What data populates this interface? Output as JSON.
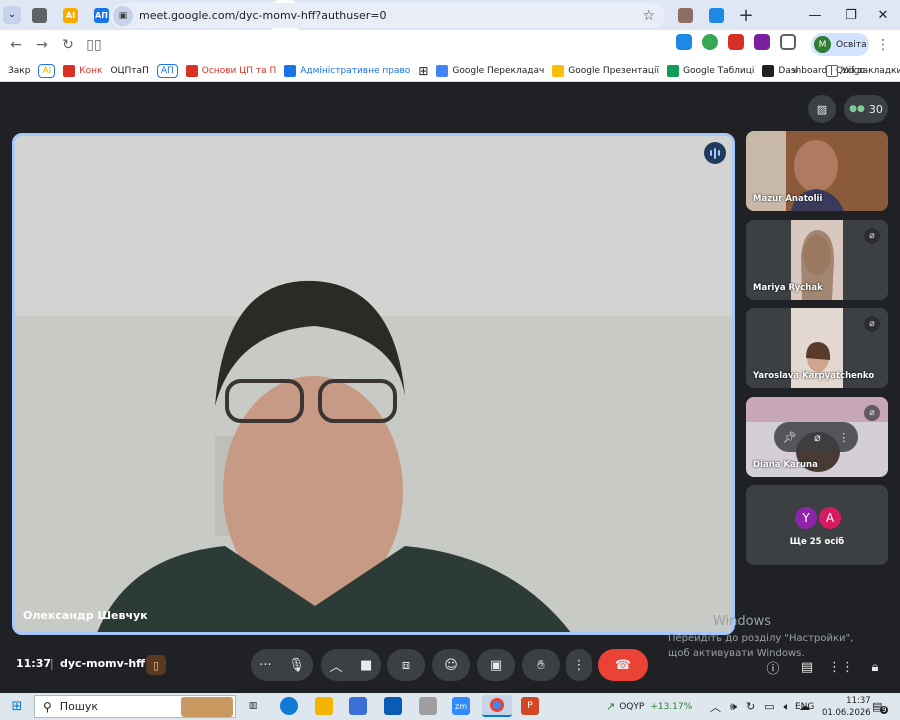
{
  "browser": {
    "tabs": [
      {
        "icon": "chrome-icon",
        "color": "#5f6368",
        "label": ""
      },
      {
        "icon": "ai-icon",
        "color": "#f9ab00",
        "label": "AI"
      },
      {
        "icon": "ap-icon",
        "color": "#1a73e8",
        "label": "АП"
      },
      {
        "icon": "graduation-icon",
        "color": "#8a5a2b",
        "label": ""
      },
      {
        "icon": "chrome-icon",
        "color": "#5f6368",
        "label": ""
      },
      {
        "icon": "drive-icon",
        "color": "#34a853",
        "label": ""
      },
      {
        "icon": "sheets-icon",
        "color": "#0f9d58",
        "label": ""
      },
      {
        "icon": "image-icon",
        "color": "#1a73e8",
        "label": ""
      },
      {
        "icon": "meet-icon",
        "color": "#fbbc04",
        "label": ""
      },
      {
        "icon": "openai-icon",
        "color": "#202124",
        "label": ""
      },
      {
        "icon": "slides-icon",
        "color": "#fbbc04",
        "label": ""
      },
      {
        "icon": "slides-icon",
        "color": "#fbbc04",
        "label": ""
      },
      {
        "icon": "trident-icon",
        "color": "#1a3f9e",
        "label": ""
      },
      {
        "icon": "trident-icon",
        "color": "#1a3f9e",
        "label": ""
      },
      {
        "icon": "trident-icon",
        "color": "#1a3f9e",
        "label": ""
      },
      {
        "icon": "trident-icon",
        "color": "#1a3f9e",
        "label": ""
      },
      {
        "icon": "trident-icon",
        "color": "#1a3f9e",
        "label": ""
      },
      {
        "icon": "globe-icon",
        "color": "#3c5a80",
        "label": ""
      },
      {
        "icon": "trident-icon",
        "color": "#1a3f9e",
        "label": ""
      },
      {
        "icon": "sprout-icon",
        "color": "#7cb342",
        "label": ""
      },
      {
        "icon": "castle-icon",
        "color": "#8d6e63",
        "label": ""
      },
      {
        "icon": "kite-icon",
        "color": "#1e88e5",
        "label": ""
      }
    ],
    "url": "meet.google.com/dyc-momv-hff?authuser=0",
    "profile_name": "Освіта",
    "profile_initial": "M",
    "bookmarks": [
      {
        "label": "Закр",
        "color": "",
        "pill": false
      },
      {
        "label": "AI",
        "color": "#f9ab00",
        "pill": true
      },
      {
        "label": "Конк",
        "color": "#d93025",
        "pill": false
      },
      {
        "label": "ОЦПтаП",
        "color": "",
        "pill": false
      },
      {
        "label": "АП",
        "color": "#1a73e8",
        "pill": true
      },
      {
        "label": "Основи ЦП та П",
        "color": "#d93025",
        "pill": false
      },
      {
        "label": "Адміністративне право",
        "color": "#1a73e8",
        "pill": false
      },
      {
        "label": "Google Перекладач",
        "color": "#4285f4",
        "pill": false
      },
      {
        "label": "Google Презентації",
        "color": "#fbbc04",
        "pill": false
      },
      {
        "label": "Google Таблиці",
        "color": "#0f9d58",
        "pill": false
      },
      {
        "label": "Dashboard | Quilgo",
        "color": "#202124",
        "pill": false
      }
    ],
    "all_bookmarks": "Усі закладки"
  },
  "meet": {
    "participant_count": "30",
    "main_speaker": "Олександр Шевчук",
    "tiles": [
      {
        "name": "Mazur Anatolii",
        "muted": false
      },
      {
        "name": "Mariya Rychak",
        "muted": true
      },
      {
        "name": "Yaroslava Karpyatchenko",
        "muted": true
      },
      {
        "name": "Diana Karuna",
        "muted": true
      }
    ],
    "more_avatars": [
      {
        "initial": "Y",
        "color": "#8e24aa"
      },
      {
        "initial": "A",
        "color": "#d81b60"
      }
    ],
    "more_label": "Ще 25 осіб",
    "time": "11:37",
    "meeting_code": "dyc-momv-hff"
  },
  "watermark": {
    "title": "Windows",
    "text": "Перейдіть до розділу \"Настройки\", щоб активувати Windows."
  },
  "taskbar": {
    "search_placeholder": "Пошук",
    "stock_ticker": "OQYP",
    "stock_change": "+13.17%",
    "language": "ENG",
    "time": "11:37",
    "date": "01.06.2026",
    "notification_count": "9"
  }
}
